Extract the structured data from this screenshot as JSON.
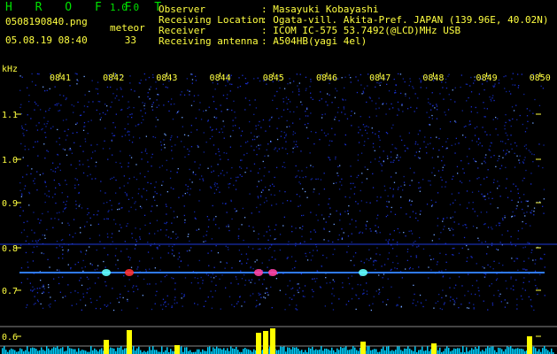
{
  "header": {
    "app_title": "H R O F F T",
    "version": "1.0.0",
    "filename": "0508190840.png",
    "datetime": "05.08.19 08:40",
    "meteor_label": "meteor",
    "meteor_count": "33",
    "observer_label": "Observer",
    "observer_value": ": Masayuki Kobayashi",
    "location_label": "Receiving Location",
    "location_value": ": Ogata-vill. Akita-Pref. JAPAN (139.96E, 40.02N)",
    "receiver_label": "Receiver",
    "receiver_value": ": ICOM IC-575 53.7492(@LCD)MHz USB",
    "antenna_label": "Receiving antenna",
    "antenna_value": ": A504HB(yagi 4el)"
  },
  "axis": {
    "y_unit": "kHz",
    "y_ticks": [
      "1.1",
      "1.0",
      "0.9",
      "0.8",
      "0.7",
      "0.6"
    ],
    "time_ticks": [
      "0841",
      "0842",
      "0843",
      "0844",
      "0845",
      "0846",
      "0847",
      "0848",
      "0849",
      "0850"
    ]
  },
  "colors": {
    "background": "#000000",
    "title": "#00e000",
    "text": "#ffff40",
    "noise": "#1a2fd0",
    "signal_line": "#3080ff",
    "histogram_cyan": "#00d0ff",
    "histogram_yellow": "#ffff00"
  }
}
